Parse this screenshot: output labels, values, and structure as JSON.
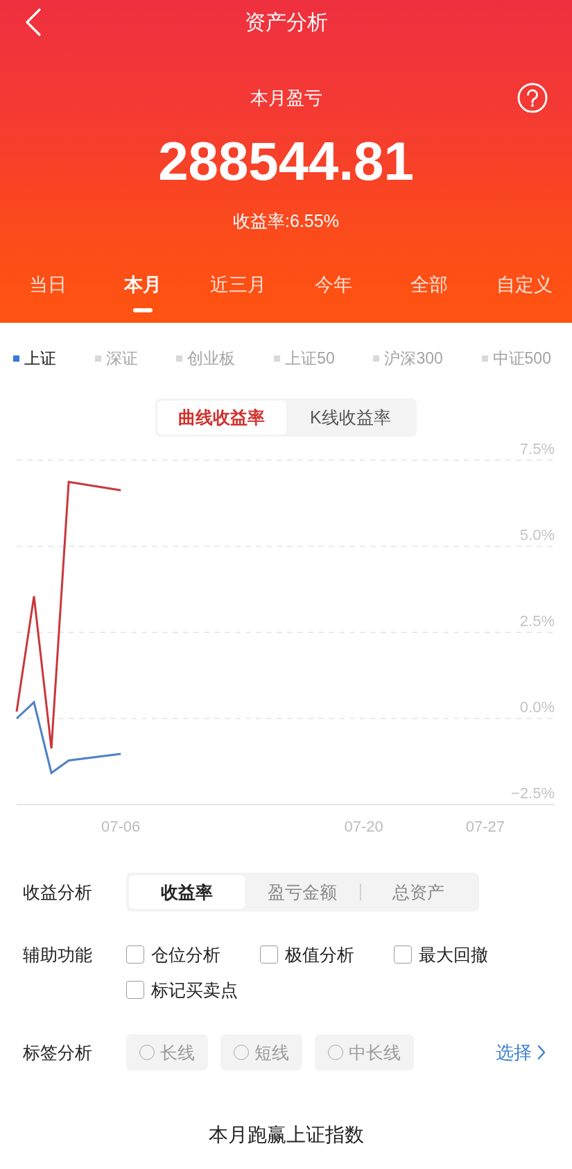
{
  "header": {
    "title": "资产分析"
  },
  "summary": {
    "label": "本月盈亏",
    "amount": "288544.81",
    "return_rate": "收益率:6.55%"
  },
  "period_tabs": [
    {
      "label": "当日",
      "selected": false
    },
    {
      "label": "本月",
      "selected": true
    },
    {
      "label": "近三月",
      "selected": false
    },
    {
      "label": "今年",
      "selected": false
    },
    {
      "label": "全部",
      "selected": false
    },
    {
      "label": "自定义",
      "selected": false
    }
  ],
  "index_legend": [
    {
      "label": "上证",
      "selected": true
    },
    {
      "label": "深证",
      "selected": false
    },
    {
      "label": "创业板",
      "selected": false
    },
    {
      "label": "上证50",
      "selected": false
    },
    {
      "label": "沪深300",
      "selected": false
    },
    {
      "label": "中证500",
      "selected": false
    }
  ],
  "chart_mode_toggle": [
    {
      "label": "曲线收益率",
      "selected": true
    },
    {
      "label": "K线收益率",
      "selected": false
    }
  ],
  "chart": {
    "chart_data": {
      "type": "line",
      "grid": true,
      "categories": [
        null,
        null,
        null,
        null,
        null,
        null,
        "07-06",
        null,
        null,
        null,
        null,
        null,
        null,
        null,
        null,
        null,
        null,
        null,
        null,
        null,
        "07-20",
        null,
        null,
        null,
        null,
        null,
        null,
        "07-27",
        null,
        null,
        null,
        null
      ],
      "ylim": [
        -2.5,
        7.5
      ],
      "yticks": [
        {
          "value": -2.5,
          "label": "−2.5%"
        },
        {
          "value": 0,
          "label": "0.0%"
        },
        {
          "value": 2.5,
          "label": "2.5%"
        },
        {
          "value": 5,
          "label": "5.0%"
        },
        {
          "value": 7.5,
          "label": "7.5%"
        }
      ],
      "series": [
        {
          "color": "#c9373b",
          "values": [
            0.2,
            3.55,
            -0.87,
            6.87,
            null,
            null,
            6.63,
            null,
            null,
            null,
            null,
            null,
            null,
            null,
            null,
            null,
            null,
            null,
            null,
            null,
            null,
            null,
            null,
            null,
            null,
            null,
            null,
            null,
            null,
            null,
            null,
            null
          ]
        },
        {
          "color": "#4d80c6",
          "values": [
            0,
            0.47,
            -1.58,
            -1.22,
            null,
            null,
            -1.03,
            null,
            null,
            null,
            null,
            null,
            null,
            null,
            null,
            null,
            null,
            null,
            null,
            null,
            null,
            null,
            null,
            null,
            null,
            null,
            null,
            null,
            null,
            null,
            null,
            null
          ]
        }
      ]
    }
  },
  "analysis": {
    "label": "收益分析",
    "options": [
      {
        "label": "收益率",
        "selected": true
      },
      {
        "label": "盈亏金额",
        "selected": false
      },
      {
        "label": "总资产",
        "selected": false
      }
    ]
  },
  "auxiliary": {
    "label": "辅助功能",
    "options": [
      {
        "label": "仓位分析",
        "checked": false
      },
      {
        "label": "极值分析",
        "checked": false
      },
      {
        "label": "最大回撤",
        "checked": false
      },
      {
        "label": "标记买卖点",
        "checked": false
      }
    ]
  },
  "tags": {
    "label": "标签分析",
    "options": [
      {
        "label": "长线",
        "selected": false
      },
      {
        "label": "短线",
        "selected": false
      },
      {
        "label": "中长线",
        "selected": false
      }
    ],
    "choose_link": "选择"
  },
  "footer": {
    "text": "本月跑赢上证指数"
  }
}
